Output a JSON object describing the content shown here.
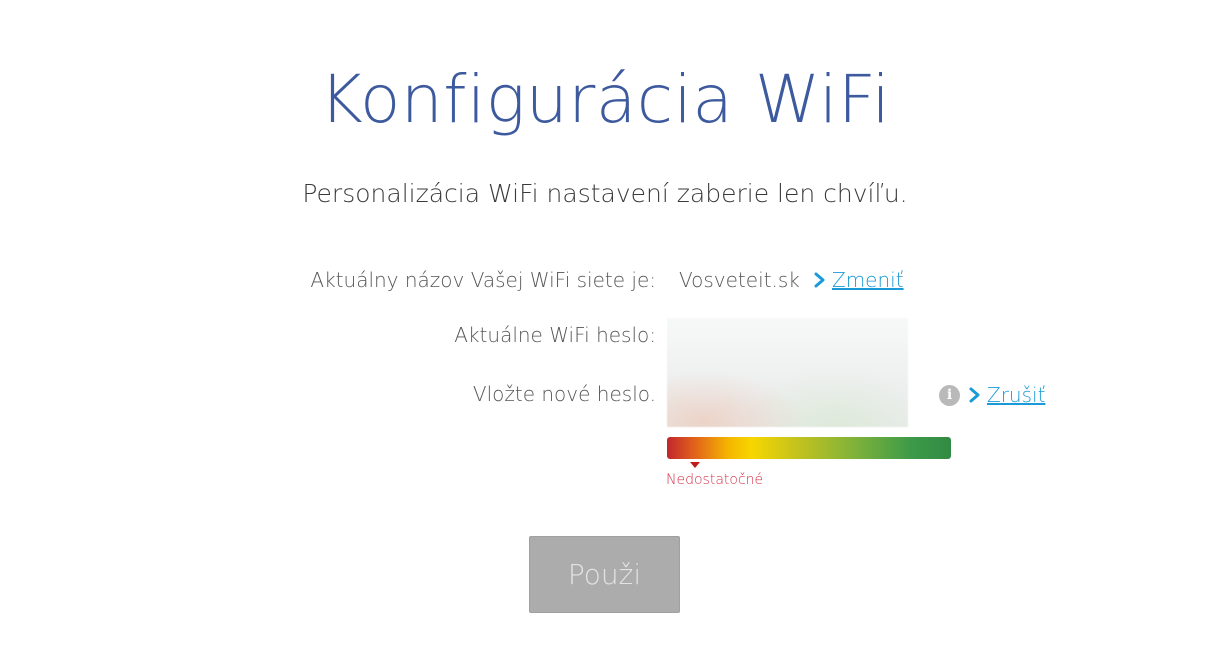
{
  "page": {
    "title": "Konfigurácia WiFi",
    "subtitle": "Personalizácia WiFi nastavení zaberie len chvíľu."
  },
  "network": {
    "name_label": "Aktuálny názov Vašej WiFi siete je:",
    "name_value": "Vosveteit.sk",
    "change_link": "Zmeniť"
  },
  "password": {
    "current_label": "Aktuálne WiFi heslo:",
    "new_label": "Vložte nové heslo.",
    "cancel_link": "Zrušiť",
    "info_icon": "i"
  },
  "strength": {
    "level_fraction": 0.1,
    "label": "Nedostatočné"
  },
  "actions": {
    "apply_label": "Použi"
  },
  "colors": {
    "title": "#3d5a9e",
    "link": "#1a9ad6",
    "strength_label": "#d6324a",
    "button_disabled": "#acacac"
  }
}
